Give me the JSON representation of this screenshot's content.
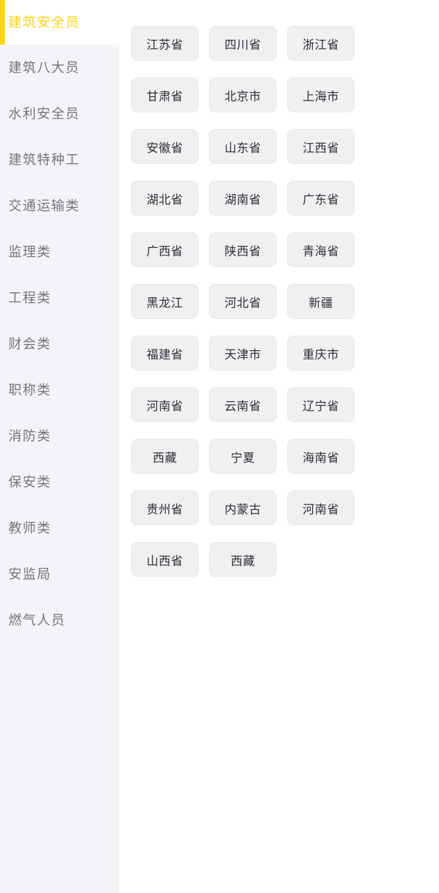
{
  "colors": {
    "accent": "#fcd418",
    "sidebar_bg": "#f4f4f8",
    "sidebar_text": "#74747c",
    "button_bg": "#f0f0f3",
    "button_text": "#2e2e33",
    "main_bg": "#ffffff"
  },
  "sidebar": {
    "active_index": 0,
    "items": [
      {
        "label": "建筑安全员",
        "active": true
      },
      {
        "label": "建筑八大员",
        "active": false
      },
      {
        "label": "水利安全员",
        "active": false
      },
      {
        "label": "建筑特种工",
        "active": false
      },
      {
        "label": "交通运输类",
        "active": false
      },
      {
        "label": "监理类",
        "active": false
      },
      {
        "label": "工程类",
        "active": false
      },
      {
        "label": "财会类",
        "active": false
      },
      {
        "label": "职称类",
        "active": false
      },
      {
        "label": "消防类",
        "active": false
      },
      {
        "label": "保安类",
        "active": false
      },
      {
        "label": "教师类",
        "active": false
      },
      {
        "label": "安监局",
        "active": false
      },
      {
        "label": "燃气人员",
        "active": false
      }
    ]
  },
  "main": {
    "regions": [
      {
        "label": "江苏省"
      },
      {
        "label": "四川省"
      },
      {
        "label": "浙江省"
      },
      {
        "label": "甘肃省"
      },
      {
        "label": "北京市"
      },
      {
        "label": "上海市"
      },
      {
        "label": "安徽省"
      },
      {
        "label": "山东省"
      },
      {
        "label": "江西省"
      },
      {
        "label": "湖北省"
      },
      {
        "label": "湖南省"
      },
      {
        "label": "广东省"
      },
      {
        "label": "广西省"
      },
      {
        "label": "陕西省"
      },
      {
        "label": "青海省"
      },
      {
        "label": "黑龙江"
      },
      {
        "label": "河北省"
      },
      {
        "label": "新疆"
      },
      {
        "label": "福建省"
      },
      {
        "label": "天津市"
      },
      {
        "label": "重庆市"
      },
      {
        "label": "河南省"
      },
      {
        "label": "云南省"
      },
      {
        "label": "辽宁省"
      },
      {
        "label": "西藏"
      },
      {
        "label": "宁夏"
      },
      {
        "label": "海南省"
      },
      {
        "label": "贵州省"
      },
      {
        "label": "内蒙古"
      },
      {
        "label": "河南省"
      },
      {
        "label": "山西省"
      },
      {
        "label": "西藏"
      }
    ]
  }
}
